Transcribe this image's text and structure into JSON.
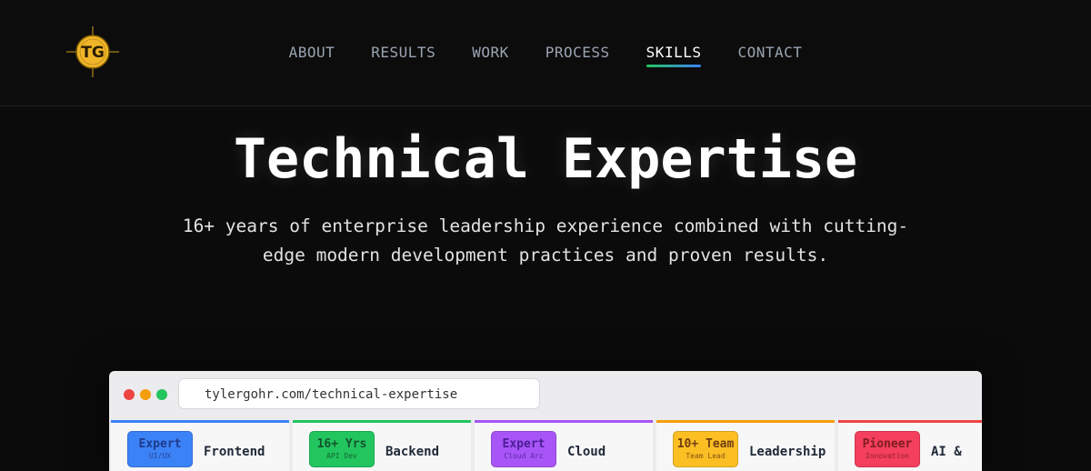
{
  "logo": {
    "text": "TG"
  },
  "nav": {
    "items": [
      {
        "label": "ABOUT"
      },
      {
        "label": "RESULTS"
      },
      {
        "label": "WORK"
      },
      {
        "label": "PROCESS"
      },
      {
        "label": "SKILLS"
      },
      {
        "label": "CONTACT"
      }
    ],
    "active": "SKILLS"
  },
  "hero": {
    "title": "Technical Expertise",
    "subtitle": "16+ years of enterprise leadership experience combined with cutting-edge modern development practices and proven results."
  },
  "browser": {
    "url": "tylergohr.com/technical-expertise",
    "dot_colors": [
      "#ef4444",
      "#f59e0b",
      "#22c55e"
    ]
  },
  "cards": [
    {
      "badge": "Expert",
      "badge_sub": "UI/UX",
      "title": "Frontend",
      "accent": "#3b82f6",
      "badge_bg": "#3b82f6",
      "badge_color": "#1e3a8a"
    },
    {
      "badge": "16+ Yrs",
      "badge_sub": "API Dev",
      "title": "Backend",
      "accent": "#22c55e",
      "badge_bg": "#22c55e",
      "badge_color": "#14532d"
    },
    {
      "badge": "Expert",
      "badge_sub": "Cloud Arc",
      "title": "Cloud",
      "accent": "#a855f7",
      "badge_bg": "#a855f7",
      "badge_color": "#4c1d95"
    },
    {
      "badge": "10+ Team",
      "badge_sub": "Team Lead",
      "title": "Leadership",
      "accent": "#f59e0b",
      "badge_bg": "#fbbf24",
      "badge_color": "#713f12"
    },
    {
      "badge": "Pioneer",
      "badge_sub": "Innovation",
      "title": "AI &",
      "accent": "#ef4444",
      "badge_bg": "#f43f5e",
      "badge_color": "#7f1d1d"
    }
  ]
}
